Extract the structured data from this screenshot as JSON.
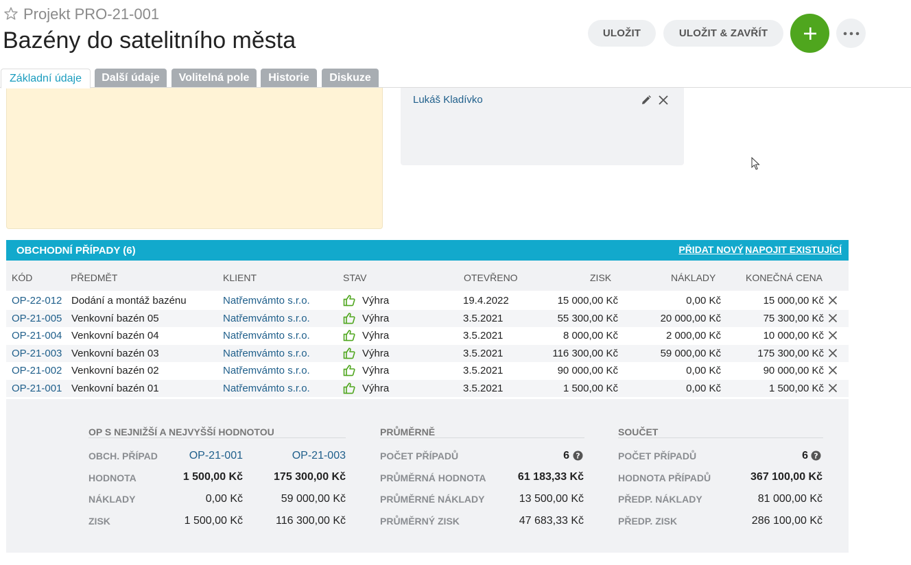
{
  "header": {
    "project_label": "Projekt PRO-21-001",
    "title": "Bazény do satelitního města",
    "save_label": "ULOŽIT",
    "save_close_label": "ULOŽIT & ZAVŘÍT",
    "add_icon": "plus-icon",
    "more_icon": "more-horizontal-icon"
  },
  "tabs": [
    {
      "label": "Základní údaje",
      "active": true
    },
    {
      "label": "Další údaje"
    },
    {
      "label": "Volitelná pole"
    },
    {
      "label": "Historie"
    },
    {
      "label": "Diskuze"
    }
  ],
  "people_panel": {
    "person": "Lukáš Kladívko"
  },
  "deals": {
    "title": "OBCHODNÍ PŘÍPADY (6)",
    "add_new": "PŘIDAT NOVÝ",
    "link_existing": "NAPOJIT EXISTUJÍCÍ",
    "columns": [
      "KÓD",
      "PŘEDMĚT",
      "KLIENT",
      "STAV",
      "OTEVŘENO O",
      "ZISK",
      "NÁKLADY",
      "KONEČNÁ CENA"
    ],
    "rows": [
      {
        "code": "OP-22-012",
        "subject": "Dodání a montáž bazénu",
        "client": "Natřemvámto s.r.o.",
        "status": "Výhra",
        "opened": "19.4.2022",
        "profit": "15 000,00 Kč",
        "costs": "0,00 Kč",
        "final": "15 000,00 Kč"
      },
      {
        "code": "OP-21-005",
        "subject": "Venkovní bazén 05",
        "client": "Natřemvámto s.r.o.",
        "status": "Výhra",
        "opened": "3.5.2021",
        "profit": "55 300,00 Kč",
        "costs": "20 000,00 Kč",
        "final": "75 300,00 Kč"
      },
      {
        "code": "OP-21-004",
        "subject": "Venkovní bazén 04",
        "client": "Natřemvámto s.r.o.",
        "status": "Výhra",
        "opened": "3.5.2021",
        "profit": "8 000,00 Kč",
        "costs": "2 000,00 Kč",
        "final": "10 000,00 Kč"
      },
      {
        "code": "OP-21-003",
        "subject": "Venkovní bazén 03",
        "client": "Natřemvámto s.r.o.",
        "status": "Výhra",
        "opened": "3.5.2021",
        "profit": "116 300,00 Kč",
        "costs": "59 000,00 Kč",
        "final": "175 300,00 Kč"
      },
      {
        "code": "OP-21-002",
        "subject": "Venkovní bazén 02",
        "client": "Natřemvámto s.r.o.",
        "status": "Výhra",
        "opened": "3.5.2021",
        "profit": "90 000,00 Kč",
        "costs": "0,00 Kč",
        "final": "90 000,00 Kč"
      },
      {
        "code": "OP-21-001",
        "subject": "Venkovní bazén 01",
        "client": "Natřemvámto s.r.o.",
        "status": "Výhra",
        "opened": "3.5.2021",
        "profit": "1 500,00 Kč",
        "costs": "0,00 Kč",
        "final": "1 500,00 Kč"
      }
    ]
  },
  "summary": {
    "minmax": {
      "title": "OP S NEJNIŽŠÍ A NEJVYŠŠÍ HODNOTOU",
      "rows": [
        {
          "label": "OBCH. PŘÍPAD",
          "low": "OP-21-001",
          "high": "OP-21-003"
        },
        {
          "label": "HODNOTA",
          "low": "1 500,00 Kč",
          "high": "175 300,00 Kč"
        },
        {
          "label": "NÁKLADY",
          "low": "0,00 Kč",
          "high": "59 000,00 Kč"
        },
        {
          "label": "ZISK",
          "low": "1 500,00 Kč",
          "high": "116 300,00 Kč"
        }
      ]
    },
    "average": {
      "title": "PRŮMĚRNĚ",
      "rows": [
        {
          "label": "POČET PŘÍPADŮ",
          "value": "6"
        },
        {
          "label": "PRŮMĚRNÁ HODNOTA",
          "value": "61 183,33 Kč"
        },
        {
          "label": "PRŮMĚRNÉ NÁKLADY",
          "value": "13 500,00 Kč"
        },
        {
          "label": "PRŮMĚRNÝ ZISK",
          "value": "47 683,33 Kč"
        }
      ]
    },
    "total": {
      "title": "SOUČET",
      "rows": [
        {
          "label": "POČET PŘÍPADŮ",
          "value": "6"
        },
        {
          "label": "HODNOTA PŘÍPADŮ",
          "value": "367 100,00 Kč"
        },
        {
          "label": "PŘEDP. NÁKLADY",
          "value": "81 000,00 Kč"
        },
        {
          "label": "PŘEDP. ZISK",
          "value": "286 100,00 Kč"
        }
      ]
    }
  },
  "colors": {
    "accent": "#12a9cc",
    "add_button": "#4fa61e",
    "link": "#1f5f8b",
    "note_bg": "#fff3d6"
  }
}
